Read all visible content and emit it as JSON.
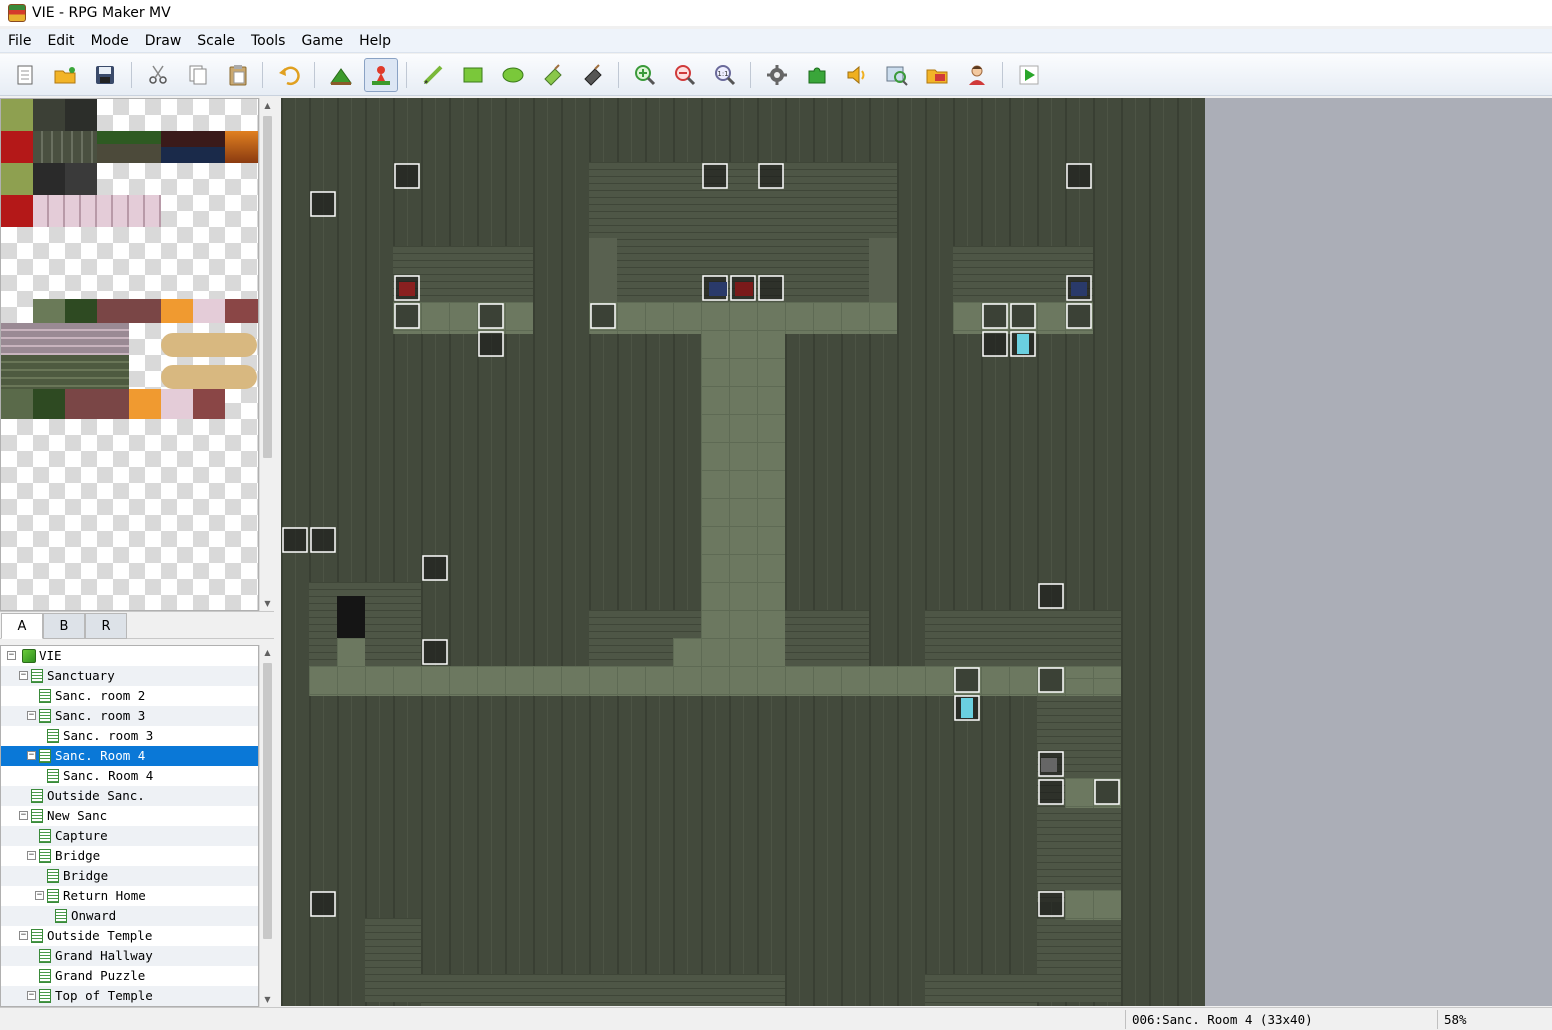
{
  "window": {
    "title": "VIE - RPG Maker MV"
  },
  "menu": [
    "File",
    "Edit",
    "Mode",
    "Draw",
    "Scale",
    "Tools",
    "Game",
    "Help"
  ],
  "toolbar": [
    {
      "name": "new-project-icon"
    },
    {
      "name": "open-project-icon"
    },
    {
      "name": "save-project-icon"
    },
    {
      "name": "cut-icon"
    },
    {
      "name": "copy-icon"
    },
    {
      "name": "paste-icon"
    },
    {
      "name": "undo-icon"
    },
    {
      "name": "map-mode-icon"
    },
    {
      "name": "event-mode-icon",
      "active": true
    },
    {
      "name": "pencil-icon"
    },
    {
      "name": "rectangle-icon"
    },
    {
      "name": "ellipse-icon"
    },
    {
      "name": "fill-icon"
    },
    {
      "name": "shadow-pen-icon"
    },
    {
      "name": "zoom-in-icon"
    },
    {
      "name": "zoom-out-icon"
    },
    {
      "name": "actual-size-icon"
    },
    {
      "name": "database-icon"
    },
    {
      "name": "plugin-manager-icon"
    },
    {
      "name": "sound-test-icon"
    },
    {
      "name": "event-searcher-icon"
    },
    {
      "name": "resource-manager-icon"
    },
    {
      "name": "character-generator-icon"
    },
    {
      "name": "playtest-icon"
    }
  ],
  "palette_tabs": [
    "A",
    "B",
    "R"
  ],
  "selected_palette_tab": "A",
  "map_tree": [
    {
      "label": "VIE",
      "depth": 0,
      "expander": "−",
      "kind": "project"
    },
    {
      "label": "Sanctuary",
      "depth": 1,
      "expander": "−"
    },
    {
      "label": "Sanc. room 2",
      "depth": 2
    },
    {
      "label": "Sanc. room 3",
      "depth": 2,
      "expander": "−"
    },
    {
      "label": "Sanc. room 3",
      "depth": 3
    },
    {
      "label": "Sanc. Room 4",
      "depth": 2,
      "expander": "−",
      "selected": true
    },
    {
      "label": "Sanc. Room 4",
      "depth": 3
    },
    {
      "label": "Outside Sanc.",
      "depth": 1
    },
    {
      "label": "New Sanc",
      "depth": 1,
      "expander": "−"
    },
    {
      "label": "Capture",
      "depth": 2
    },
    {
      "label": "Bridge",
      "depth": 2,
      "expander": "−"
    },
    {
      "label": "Bridge",
      "depth": 3
    },
    {
      "label": "Return Home",
      "depth": 3,
      "expander": "−"
    },
    {
      "label": "Onward",
      "depth": 4
    },
    {
      "label": "Outside Temple",
      "depth": 1,
      "expander": "−"
    },
    {
      "label": "Grand Hallway",
      "depth": 2
    },
    {
      "label": "Grand Puzzle",
      "depth": 2
    },
    {
      "label": "Top of Temple",
      "depth": 2,
      "expander": "−"
    }
  ],
  "status": {
    "map": "006:Sanc. Room 4 (33x40)",
    "zoom": "58%"
  },
  "colors": {
    "selection": "#0a78d7",
    "map_dark": "#3e4536",
    "map_wall": "#4e5646",
    "map_floor": "#6e7a60"
  }
}
